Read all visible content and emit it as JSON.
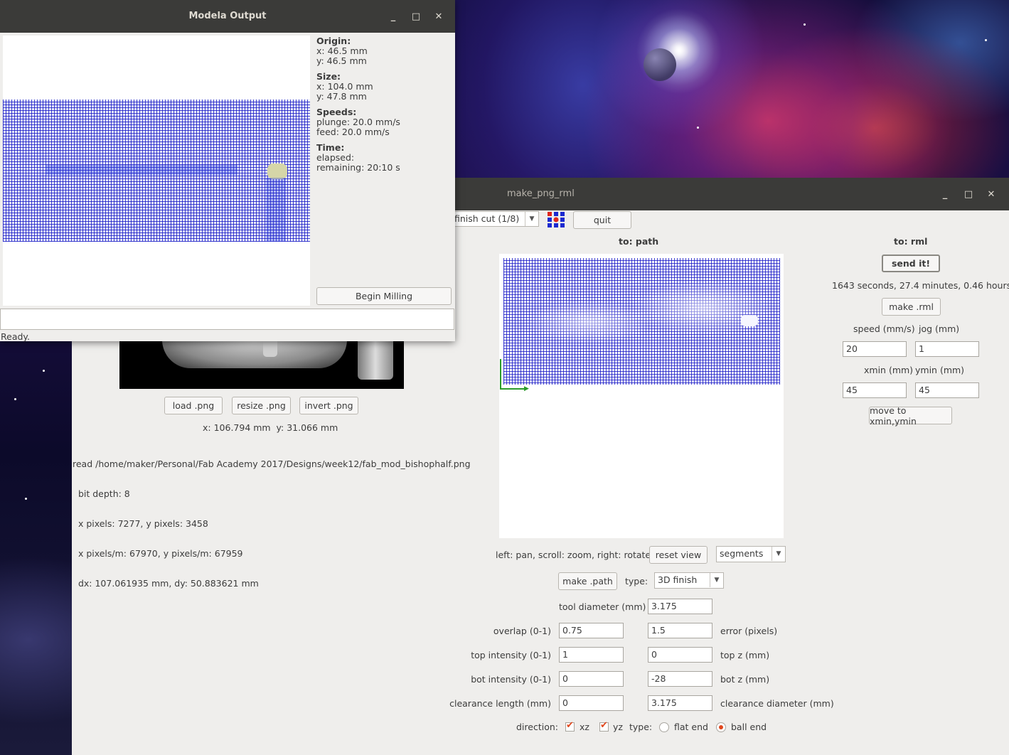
{
  "modela": {
    "title": "Modela Output",
    "controls": {
      "minimize": "_",
      "maximize": "□",
      "close": "✕"
    },
    "origin_heading": "Origin:",
    "origin_x": "x: 46.5 mm",
    "origin_y": "y: 46.5 mm",
    "size_heading": "Size:",
    "size_x": "x: 104.0 mm",
    "size_y": "y: 47.8 mm",
    "speeds_heading": "Speeds:",
    "plunge": "plunge: 20.0 mm/s",
    "feed": "feed: 20.0 mm/s",
    "time_heading": "Time:",
    "elapsed": "elapsed:",
    "remaining": "remaining: 20:10 s",
    "begin_button": "Begin Milling",
    "status": "Ready."
  },
  "rml": {
    "title": "make_png_rml",
    "controls": {
      "minimize": "_",
      "maximize": "□",
      "close": "✕"
    },
    "process_select": "finish cut (1/8)",
    "quit_button": "quit",
    "path_heading": "to: path",
    "rml_heading": "to: rml",
    "send_button": "send it!",
    "time_estimate": "1643 seconds, 27.4 minutes, 0.46 hours",
    "make_rml_button": "make .rml",
    "speed_label": "speed (mm/s)",
    "jog_label": "jog (mm)",
    "speed_value": "20",
    "jog_value": "1",
    "xmin_label": "xmin (mm)",
    "ymin_label": "ymin (mm)",
    "xmin_value": "45",
    "ymin_value": "45",
    "move_button": "move to xmin,ymin",
    "view_hint": "left: pan, scroll: zoom, right: rotate",
    "reset_view_button": "reset view",
    "view_mode": "segments",
    "make_path_button": "make .path",
    "type_label": "type:",
    "type_value": "3D finish",
    "tool_diameter_label": "tool diameter (mm)",
    "tool_diameter_value": "3.175",
    "overlap_label": "overlap (0-1)",
    "overlap_value": "0.75",
    "error_value": "1.5",
    "error_label": "error (pixels)",
    "top_intensity_label": "top intensity (0-1)",
    "top_intensity_value": "1",
    "top_z_value": "0",
    "top_z_label": "top z (mm)",
    "bot_intensity_label": "bot intensity (0-1)",
    "bot_intensity_value": "0",
    "bot_z_value": "-28",
    "bot_z_label": "bot z (mm)",
    "clearance_length_label": "clearance length (mm)",
    "clearance_length_value": "0",
    "clearance_diameter_value": "3.175",
    "clearance_diameter_label": "clearance diameter (mm)",
    "direction_label": "direction:",
    "xz_label": "xz",
    "yz_label": "yz",
    "end_type_label": "type:",
    "flat_end_label": "flat end",
    "ball_end_label": "ball end",
    "load_button": "load .png",
    "resize_button": "resize .png",
    "invert_button": "invert .png",
    "cursor_readout": "x: 106.794 mm  y: 31.066 mm",
    "file_info": [
      "read /home/maker/Personal/Fab Academy 2017/Designs/week12/fab_mod_bishophalf.png",
      "  bit depth: 8",
      "  x pixels: 7277, y pixels: 3458",
      "  x pixels/m: 67970, y pixels/m: 67959",
      "  dx: 107.061935 mm, dy: 50.883621 mm"
    ]
  }
}
